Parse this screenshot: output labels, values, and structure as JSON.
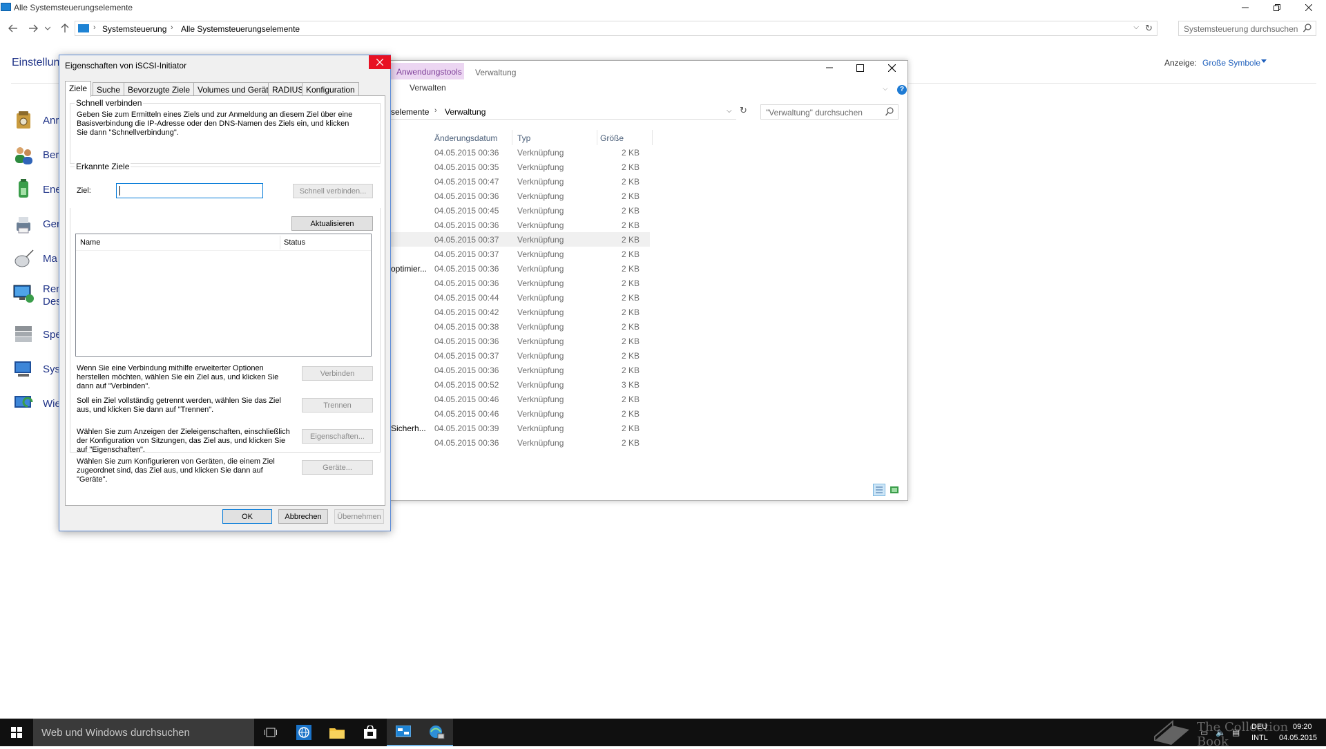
{
  "control_panel": {
    "title": "Alle Systemsteuerungselemente",
    "breadcrumb": [
      "Systemsteuerung",
      "Alle Systemsteuerungselemente"
    ],
    "search_placeholder": "Systemsteuerung durchsuchen",
    "heading_fragment": "Einstellun",
    "view_label": "Anzeige:",
    "view_value": "Große Symbole",
    "items": [
      {
        "label": "Anr",
        "icon": "admin-tools-icon"
      },
      {
        "label": "Ber",
        "icon": "users-icon"
      },
      {
        "label": "Ene",
        "icon": "power-options-icon"
      },
      {
        "label": "Ger",
        "icon": "devices-printers-icon"
      },
      {
        "label": "Ma",
        "icon": "mouse-icon"
      },
      {
        "label": "Ren",
        "label2": "Des",
        "icon": "remote-desktop-icon"
      },
      {
        "label": "Spe",
        "icon": "storage-spaces-icon"
      },
      {
        "label": "Sys",
        "icon": "system-icon"
      },
      {
        "label": "Wie",
        "icon": "recovery-icon"
      }
    ]
  },
  "explorer": {
    "ribbon_tool_group": "Anwendungstools",
    "ribbon_tab": "Verwaltung",
    "ribbon_subtab": "Verwalten",
    "address_fragment": "selemente",
    "address_current": "Verwaltung",
    "search_placeholder": "\"Verwaltung\" durchsuchen",
    "columns": {
      "date": "Änderungsdatum",
      "type": "Typ",
      "size": "Größe"
    },
    "rows": [
      {
        "frag": "",
        "date": "04.05.2015 00:36",
        "type": "Verknüpfung",
        "size": "2 KB"
      },
      {
        "frag": "",
        "date": "04.05.2015 00:35",
        "type": "Verknüpfung",
        "size": "2 KB"
      },
      {
        "frag": "",
        "date": "04.05.2015 00:47",
        "type": "Verknüpfung",
        "size": "2 KB"
      },
      {
        "frag": "",
        "date": "04.05.2015 00:36",
        "type": "Verknüpfung",
        "size": "2 KB"
      },
      {
        "frag": "",
        "date": "04.05.2015 00:45",
        "type": "Verknüpfung",
        "size": "2 KB"
      },
      {
        "frag": "",
        "date": "04.05.2015 00:36",
        "type": "Verknüpfung",
        "size": "2 KB"
      },
      {
        "frag": "",
        "date": "04.05.2015 00:37",
        "type": "Verknüpfung",
        "size": "2 KB",
        "selected": true
      },
      {
        "frag": "",
        "date": "04.05.2015 00:37",
        "type": "Verknüpfung",
        "size": "2 KB"
      },
      {
        "frag": "optimier...",
        "date": "04.05.2015 00:36",
        "type": "Verknüpfung",
        "size": "2 KB"
      },
      {
        "frag": "",
        "date": "04.05.2015 00:36",
        "type": "Verknüpfung",
        "size": "2 KB"
      },
      {
        "frag": "",
        "date": "04.05.2015 00:44",
        "type": "Verknüpfung",
        "size": "2 KB"
      },
      {
        "frag": "",
        "date": "04.05.2015 00:42",
        "type": "Verknüpfung",
        "size": "2 KB"
      },
      {
        "frag": "",
        "date": "04.05.2015 00:38",
        "type": "Verknüpfung",
        "size": "2 KB"
      },
      {
        "frag": "",
        "date": "04.05.2015 00:36",
        "type": "Verknüpfung",
        "size": "2 KB"
      },
      {
        "frag": "",
        "date": "04.05.2015 00:37",
        "type": "Verknüpfung",
        "size": "2 KB"
      },
      {
        "frag": "",
        "date": "04.05.2015 00:36",
        "type": "Verknüpfung",
        "size": "2 KB"
      },
      {
        "frag": "",
        "date": "04.05.2015 00:52",
        "type": "Verknüpfung",
        "size": "3 KB"
      },
      {
        "frag": "",
        "date": "04.05.2015 00:46",
        "type": "Verknüpfung",
        "size": "2 KB"
      },
      {
        "frag": "",
        "date": "04.05.2015 00:46",
        "type": "Verknüpfung",
        "size": "2 KB"
      },
      {
        "frag": "Sicherh...",
        "date": "04.05.2015 00:39",
        "type": "Verknüpfung",
        "size": "2 KB"
      },
      {
        "frag": "",
        "date": "04.05.2015 00:36",
        "type": "Verknüpfung",
        "size": "2 KB"
      }
    ]
  },
  "dialog": {
    "title": "Eigenschaften von iSCSI-Initiator",
    "tabs": [
      "Ziele",
      "Suche",
      "Bevorzugte Ziele",
      "Volumes und Geräte",
      "RADIUS",
      "Konfiguration"
    ],
    "active_tab": "Ziele",
    "quick_connect": {
      "legend": "Schnell verbinden",
      "description": "Geben Sie zum Ermitteln eines Ziels und zur Anmeldung an diesem Ziel über eine Basisverbindung die IP-Adresse oder den DNS-Namen des Ziels ein, und klicken Sie dann \"Schnellverbindung\".",
      "target_label": "Ziel:",
      "target_value": "",
      "button": "Schnell verbinden..."
    },
    "discovered": {
      "legend": "Erkannte Ziele",
      "refresh_button": "Aktualisieren",
      "col_name": "Name",
      "col_status": "Status"
    },
    "actions": [
      {
        "text": "Wenn Sie eine Verbindung mithilfe erweiterter Optionen herstellen möchten, wählen Sie ein Ziel aus, und klicken Sie dann auf \"Verbinden\".",
        "button": "Verbinden"
      },
      {
        "text": "Soll ein Ziel vollständig getrennt werden, wählen Sie das Ziel aus, und klicken Sie dann auf \"Trennen\".",
        "button": "Trennen"
      },
      {
        "text": "Wählen Sie zum Anzeigen der Zieleigenschaften, einschließlich der Konfiguration von Sitzungen, das Ziel aus, und klicken Sie auf \"Eigenschaften\".",
        "button": "Eigenschaften..."
      },
      {
        "text": "Wählen Sie zum Konfigurieren von Geräten, die einem Ziel zugeordnet sind, das Ziel aus, und klicken Sie dann auf \"Geräte\".",
        "button": "Geräte..."
      }
    ],
    "ok": "OK",
    "cancel": "Abbrechen",
    "apply": "Übernehmen"
  },
  "taskbar": {
    "search_placeholder": "Web und Windows durchsuchen",
    "lang1": "DEU",
    "lang2": "INTL",
    "time": "09:20",
    "date": "04.05.2015",
    "watermark": "The Collection Book"
  },
  "colors": {
    "accent": "#0078d7",
    "link_blue": "#1e3287",
    "close_red": "#e81123",
    "ribbon_tool_bg": "#ecd6f2",
    "taskbar_bg": "#101010"
  }
}
